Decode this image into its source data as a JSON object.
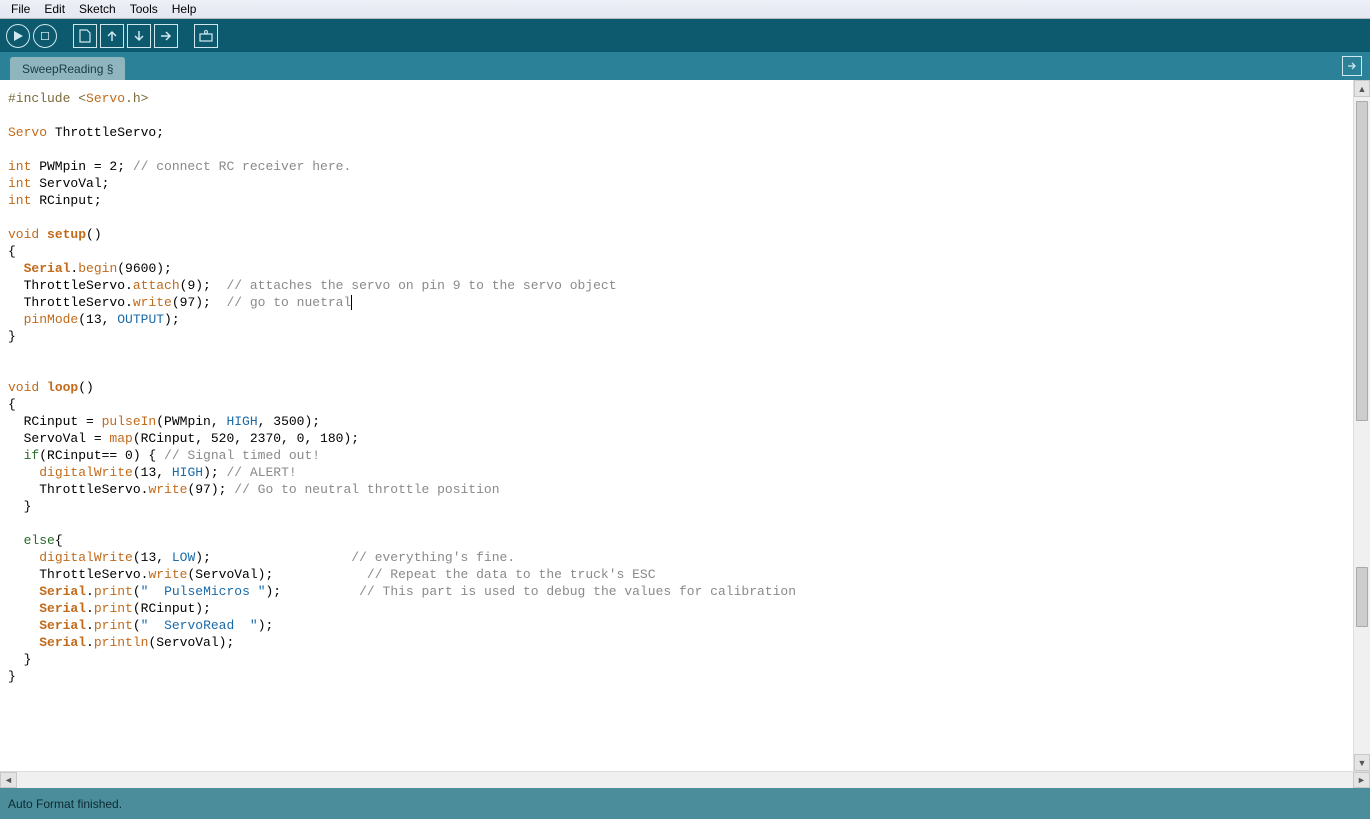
{
  "menubar": [
    "File",
    "Edit",
    "Sketch",
    "Tools",
    "Help"
  ],
  "toolbar": {
    "verify": "verify-button",
    "upload_run": "upload-button",
    "new": "new-button",
    "open": "open-button",
    "save": "save-button",
    "export": "export-button",
    "serial": "serial-monitor-button"
  },
  "tab": {
    "label": "SweepReading §"
  },
  "status": "Auto Format finished.",
  "code": {
    "l1a": "#include <",
    "l1b": "Servo",
    "l1c": ".h>",
    "l2a": "Servo",
    "l2b": " ThrottleServo;",
    "l3a": "int",
    "l3b": " PWMpin = 2; ",
    "l3c": "// connect RC receiver here.",
    "l4a": "int",
    "l4b": " ServoVal;",
    "l5a": "int",
    "l5b": " RCinput;",
    "l6a": "void",
    "l6b": " ",
    "l6c": "setup",
    "l6d": "()",
    "l7": "{",
    "l8a": "  ",
    "l8b": "Serial",
    "l8c": ".",
    "l8d": "begin",
    "l8e": "(9600);",
    "l9a": "  ThrottleServo.",
    "l9b": "attach",
    "l9c": "(9);  ",
    "l9d": "// attaches the servo on pin 9 to the servo object",
    "l10a": "  ThrottleServo.",
    "l10b": "write",
    "l10c": "(97);  ",
    "l10d": "// go to nuetral",
    "l11a": "  ",
    "l11b": "pinMode",
    "l11c": "(13, ",
    "l11d": "OUTPUT",
    "l11e": ");",
    "l12": "}",
    "l13a": "void",
    "l13b": " ",
    "l13c": "loop",
    "l13d": "()",
    "l14": "{",
    "l15a": "  RCinput = ",
    "l15b": "pulseIn",
    "l15c": "(PWMpin, ",
    "l15d": "HIGH",
    "l15e": ", 3500);",
    "l16a": "  ServoVal = ",
    "l16b": "map",
    "l16c": "(RCinput, 520, 2370, 0, 180);",
    "l17a": "  ",
    "l17b": "if",
    "l17c": "(RCinput== 0) { ",
    "l17d": "// Signal timed out!",
    "l18a": "    ",
    "l18b": "digitalWrite",
    "l18c": "(13, ",
    "l18d": "HIGH",
    "l18e": "); ",
    "l18f": "// ALERT!",
    "l19a": "    ThrottleServo.",
    "l19b": "write",
    "l19c": "(97); ",
    "l19d": "// Go to neutral throttle position",
    "l20": "  }",
    "l21a": "  ",
    "l21b": "else",
    "l21c": "{",
    "l22a": "    ",
    "l22b": "digitalWrite",
    "l22c": "(13, ",
    "l22d": "LOW",
    "l22e": ");                  ",
    "l22f": "// everything's fine.",
    "l23a": "    ThrottleServo.",
    "l23b": "write",
    "l23c": "(ServoVal);            ",
    "l23d": "// Repeat the data to the truck's ESC",
    "l24a": "    ",
    "l24b": "Serial",
    "l24c": ".",
    "l24d": "print",
    "l24e": "(",
    "l24f": "\"  PulseMicros \"",
    "l24g": ");          ",
    "l24h": "// This part is used to debug the values for calibration",
    "l25a": "    ",
    "l25b": "Serial",
    "l25c": ".",
    "l25d": "print",
    "l25e": "(RCinput);",
    "l26a": "    ",
    "l26b": "Serial",
    "l26c": ".",
    "l26d": "print",
    "l26e": "(",
    "l26f": "\"  ServoRead  \"",
    "l26g": ");",
    "l27a": "    ",
    "l27b": "Serial",
    "l27c": ".",
    "l27d": "println",
    "l27e": "(ServoVal);",
    "l28": "  }",
    "l29": "}"
  }
}
